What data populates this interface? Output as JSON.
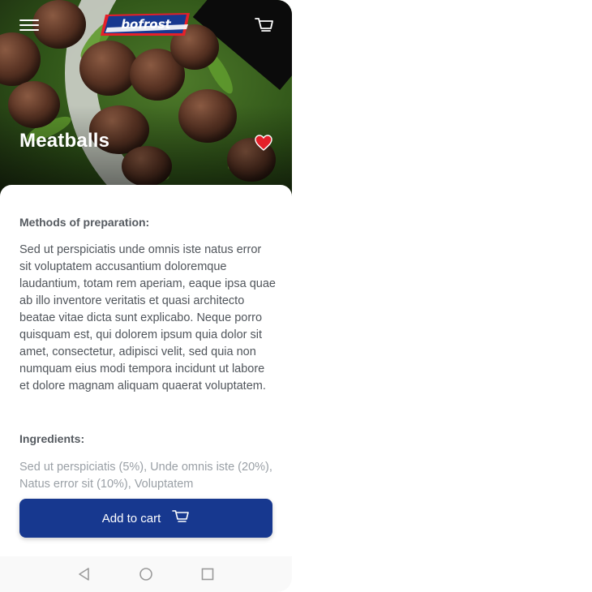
{
  "app": {
    "logo_text": "bofrost",
    "brand_colors": {
      "primary": "#17388f",
      "accent": "#e4202a",
      "heart": "#e4202a"
    }
  },
  "header": {
    "menu_icon": "hamburger-menu-icon",
    "cart_icon": "shopping-cart-icon"
  },
  "product": {
    "title": "Meatballs",
    "favorite_icon": "heart-icon",
    "favorited": true
  },
  "sections": {
    "preparation_title": "Methods of preparation:",
    "preparation_text": "Sed ut perspiciatis unde omnis iste natus error sit voluptatem accusantium doloremque laudantium, totam rem aperiam, eaque ipsa quae ab illo inventore veritatis et quasi architecto beatae vitae dicta sunt explicabo. Neque porro quisquam est, qui dolorem ipsum quia dolor sit amet, consectetur, adipisci velit, sed quia non numquam eius modi tempora incidunt ut labore et dolore magnam aliquam quaerat voluptatem.",
    "ingredients_title": "Ingredients:",
    "ingredients_text": "Sed ut perspiciatis (5%), Unde omnis iste (20%), Natus error sit (10%), Voluptatem"
  },
  "actions": {
    "add_to_cart_label": "Add to cart",
    "add_to_cart_icon": "shopping-cart-icon"
  },
  "system_nav": {
    "back_icon": "back-triangle-icon",
    "home_icon": "home-circle-icon",
    "recents_icon": "recents-square-icon"
  }
}
